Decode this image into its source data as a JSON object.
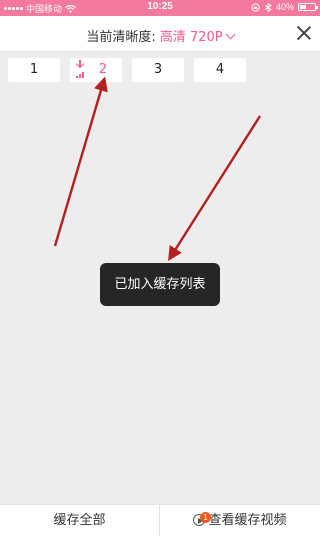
{
  "status_bar": {
    "carrier": "中国移动",
    "time": "10:25",
    "battery": "40%",
    "battery_level": 0.4
  },
  "header": {
    "label": "当前清晰度:",
    "quality": "高清 720P",
    "close_icon": "close-icon",
    "dropdown_icon": "chevron-down-icon"
  },
  "episodes": [
    {
      "label": "1",
      "cached": false
    },
    {
      "label": "2",
      "cached": true
    },
    {
      "label": "3",
      "cached": false
    },
    {
      "label": "4",
      "cached": false
    }
  ],
  "toast": "已加入缓存列表",
  "bottom_bar": {
    "cache_all": "缓存全部",
    "view_cache": "查看缓存视频",
    "badge": "1"
  },
  "colors": {
    "status_bar": "#f4799f",
    "accent": "#f45a8d",
    "annotation_arrow": "#b3201e",
    "badge": "#f25a1c"
  }
}
